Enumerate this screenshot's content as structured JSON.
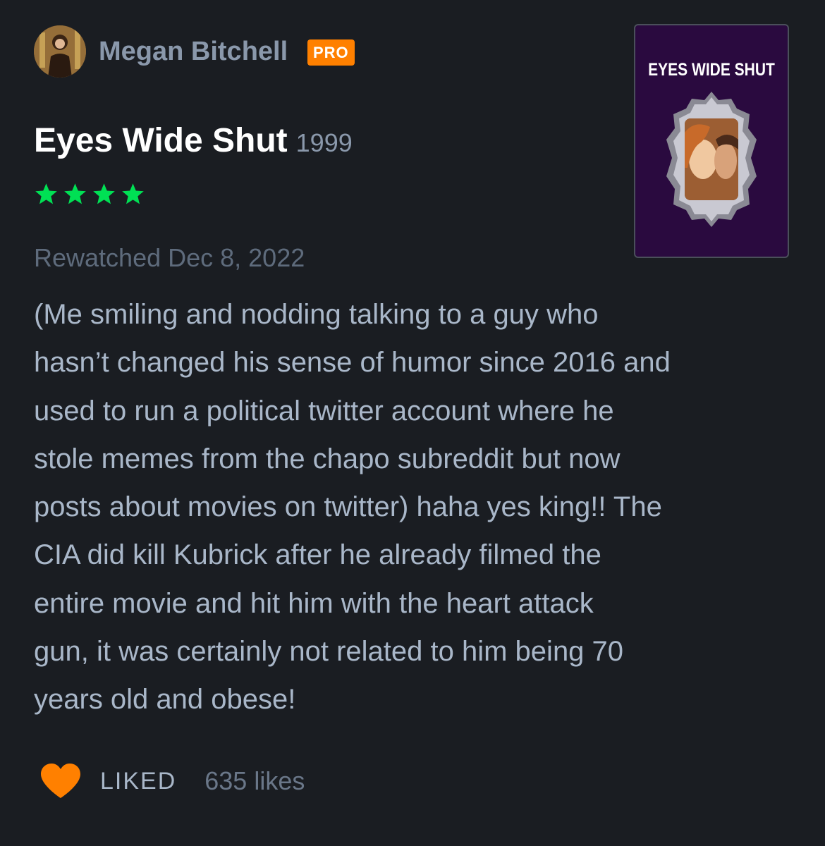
{
  "reviewer": {
    "avatar_icon": "user-avatar-icon",
    "name": "Megan Bitchell",
    "badge": "PRO"
  },
  "film": {
    "title": "Eyes Wide Shut",
    "year": "1999",
    "rating_stars": 4,
    "poster_title": "EYES WIDE SHUT"
  },
  "review": {
    "watched_label": "Rewatched Dec 8, 2022",
    "lines": [
      "(Me smiling and nodding talking to a guy who",
      "hasn’t changed his sense of humor since 2016 and",
      "used to run a political twitter account where he",
      "stole memes from the chapo subreddit but now",
      "posts about movies on twitter) haha yes king!! The",
      "CIA did kill Kubrick after he already filmed the",
      "entire movie and hit him with the heart attack",
      "gun, it was certainly not related to him being 70",
      "years old and obese!"
    ]
  },
  "likes": {
    "heart_icon": "heart-icon",
    "liked_label": "LIKED",
    "count_text": "635 likes"
  },
  "colors": {
    "background": "#1a1d22",
    "star_green": "#00e054",
    "badge_orange": "#ff8000",
    "heart_orange": "#ff8000",
    "poster_purple": "#2a0a3f"
  }
}
